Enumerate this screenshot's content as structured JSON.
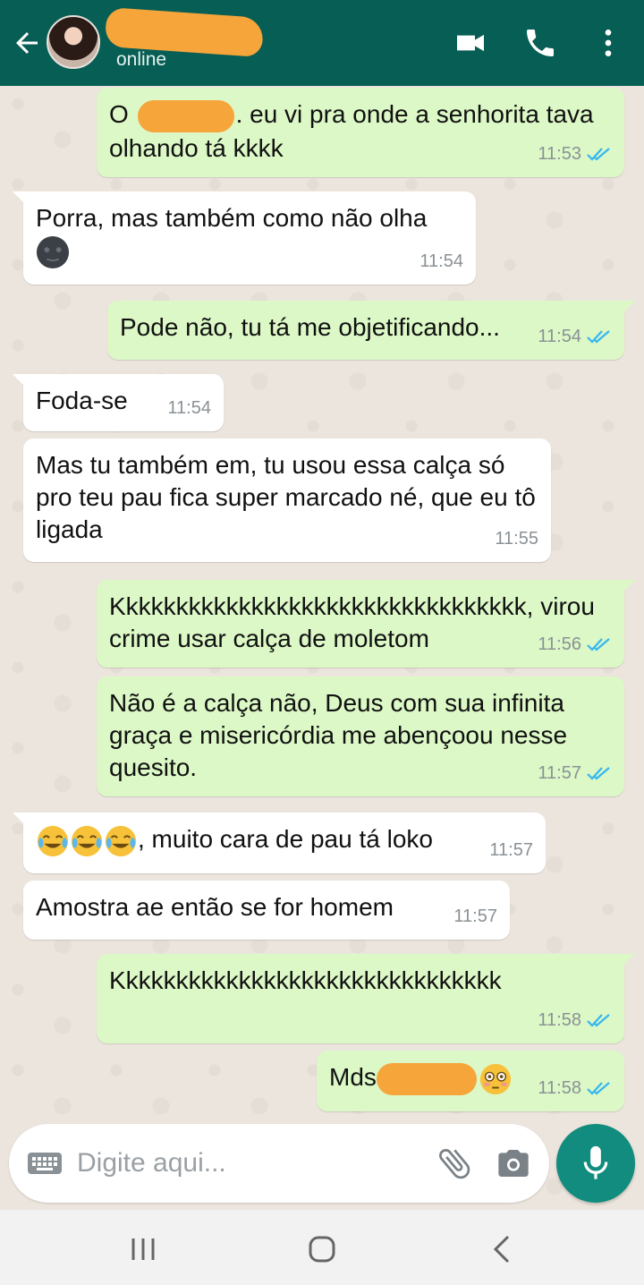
{
  "header": {
    "status": "online"
  },
  "messages": [
    {
      "from": "out",
      "before": "O ",
      "after": ". eu vi pra onde a senhorita tava olhando tá kkkk",
      "time": "11:53"
    },
    {
      "from": "in",
      "text": "Porra, mas também como não olha",
      "time": "11:54"
    },
    {
      "from": "out",
      "text": "Pode não, tu tá me objetificando...",
      "time": "11:54"
    },
    {
      "from": "in",
      "text": "Foda-se",
      "time": "11:54"
    },
    {
      "from": "in",
      "text": "Mas tu também em, tu usou essa calça só pro teu pau fica super marcado né, que eu tô ligada",
      "time": "11:55"
    },
    {
      "from": "out",
      "text": "Kkkkkkkkkkkkkkkkkkkkkkkkkkkkkkkkk, virou crime usar calça de moletom",
      "time": "11:56"
    },
    {
      "from": "out",
      "text": "Não é a calça não, Deus com sua infinita graça e misericórdia me abençoou nesse quesito.",
      "time": "11:57"
    },
    {
      "from": "in",
      "text": ", muito cara de pau tá loko",
      "time": "11:57"
    },
    {
      "from": "in",
      "text": "Amostra ae então se for homem",
      "time": "11:57"
    },
    {
      "from": "out",
      "text": "Kkkkkkkkkkkkkkkkkkkkkkkkkkkkkkk",
      "time": "11:58"
    },
    {
      "from": "out",
      "text": "Mds",
      "time": "11:58"
    }
  ],
  "input": {
    "placeholder": "Digite aqui..."
  },
  "icons": {
    "back": "arrow-left-icon",
    "video": "video-camera-icon",
    "call": "phone-icon",
    "menu": "more-vertical-icon",
    "keyboard": "keyboard-icon",
    "attach": "paperclip-icon",
    "camera": "camera-icon",
    "mic": "microphone-icon"
  },
  "colors": {
    "header": "#075e54",
    "outgoing": "#dcf8c6",
    "incoming": "#ffffff",
    "read_ticks": "#34b7f1",
    "mic_button": "#128c7e"
  }
}
